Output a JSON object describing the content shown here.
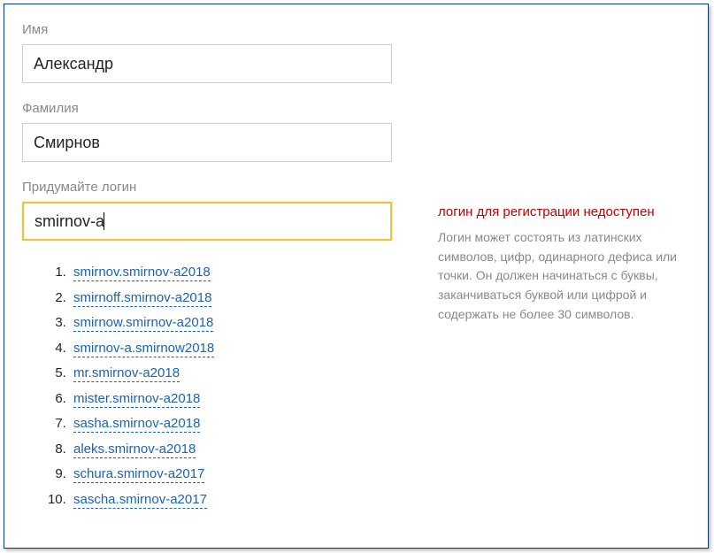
{
  "form": {
    "first_name": {
      "label": "Имя",
      "value": "Александр"
    },
    "last_name": {
      "label": "Фамилия",
      "value": "Смирнов"
    },
    "login": {
      "label": "Придумайте логин",
      "value": "smirnov-a"
    }
  },
  "validation": {
    "error_title": "логин для регистрации недоступен",
    "hint": "Логин может состоять из латинских символов, цифр, одинарного дефиса или точки. Он должен начинаться с буквы, заканчиваться буквой или цифрой и содержать не более 30 символов."
  },
  "suggestions": [
    "smirnov.smirnov-a2018",
    "smirnoff.smirnov-a2018",
    "smirnow.smirnov-a2018",
    "smirnov-a.smirnow2018",
    "mr.smirnov-a2018",
    "mister.smirnov-a2018",
    "sasha.smirnov-a2018",
    "aleks.smirnov-a2018",
    "schura.smirnov-a2017",
    "sascha.smirnov-a2017"
  ]
}
